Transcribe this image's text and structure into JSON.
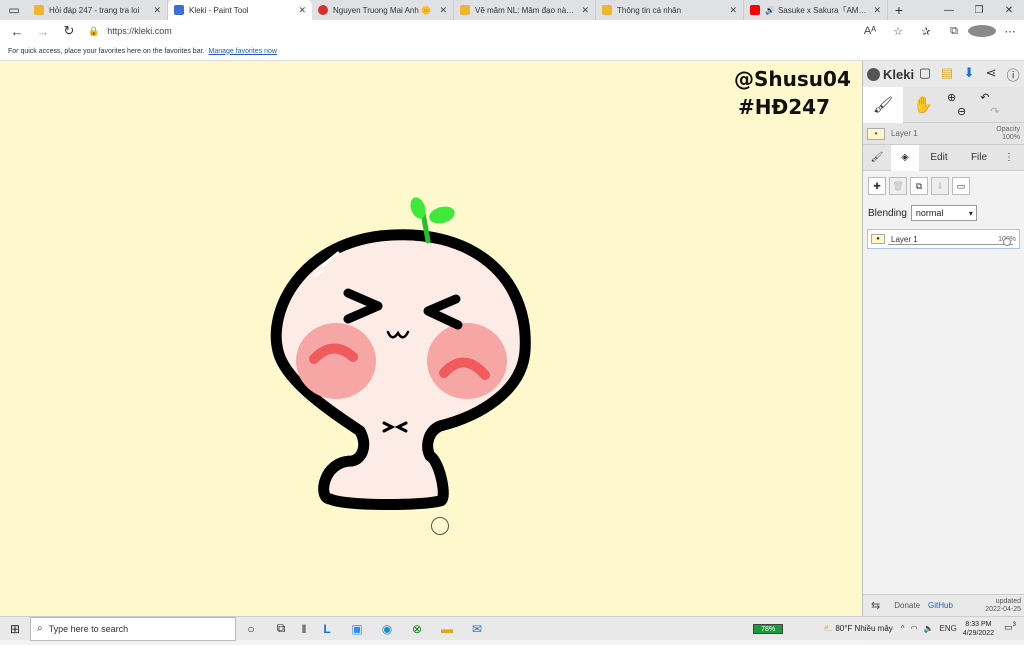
{
  "tabs": [
    {
      "title": "Hỏi đáp 247 - trang tra loi",
      "favicon_color": "#f2b62c",
      "active": false
    },
    {
      "title": "Kleki - Paint Tool",
      "favicon_color": "#3b6fd6",
      "active": true
    },
    {
      "title": "Nguyen Truong Mai Anh 🌼",
      "favicon_color": "#d93025",
      "active": false
    },
    {
      "title": "Vẽ mâm NL: Mâm đạo này ở thể...",
      "favicon_color": "#f2b62c",
      "active": false
    },
    {
      "title": "Thông tin cá nhân",
      "favicon_color": "#f2b62c",
      "active": false
    },
    {
      "title": "Sasuke x Sakura「AMV」Nar...",
      "favicon_color": "#ff0000",
      "active": false
    }
  ],
  "address": {
    "url": "https://kleki.com"
  },
  "favorites_bar": {
    "text": "For quick access, place your favorites here on the favorites bar.",
    "link": "Manage favorites now"
  },
  "canvas": {
    "bg": "#fef9cc",
    "signature_line1": "@Shusu04",
    "signature_line2": "#HĐ247"
  },
  "panel": {
    "logo": "Kleki",
    "layer_name": "Layer 1",
    "opacity_label": "Opacity",
    "opacity_value": "100%",
    "tab_edit": "Edit",
    "tab_file": "File",
    "blending_label": "Blending",
    "blending_value": "normal",
    "layers": [
      {
        "name": "Layer 1",
        "opacity": "100%"
      }
    ],
    "footer_donate": "Donate",
    "footer_github": "GitHub",
    "footer_updated": "updated",
    "footer_date": "2022-04-25"
  },
  "taskbar": {
    "search_placeholder": "Type here to search",
    "battery": "78%",
    "weather": "80°F  Nhiều mây",
    "lang": "ENG",
    "time": "8:33 PM",
    "date": "4/29/2022",
    "notifications": "3"
  }
}
